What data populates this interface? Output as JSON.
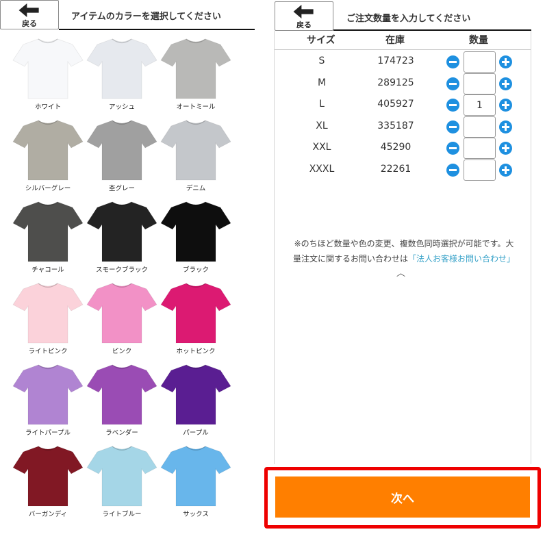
{
  "left": {
    "back_label": "戻る",
    "title": "アイテムのカラーを選択してください",
    "colors": [
      {
        "name": "ホワイト",
        "hex": "#f7f8fa"
      },
      {
        "name": "アッシュ",
        "hex": "#e6e9ee"
      },
      {
        "name": "オートミール",
        "hex": "#b9b9b7"
      },
      {
        "name": "シルバーグレー",
        "hex": "#b0ada3"
      },
      {
        "name": "杢グレー",
        "hex": "#a0a0a0"
      },
      {
        "name": "デニム",
        "hex": "#c4c7cb"
      },
      {
        "name": "チャコール",
        "hex": "#4e4e4c"
      },
      {
        "name": "スモークブラック",
        "hex": "#232323"
      },
      {
        "name": "ブラック",
        "hex": "#0e0e0e"
      },
      {
        "name": "ライトピンク",
        "hex": "#fbd2da"
      },
      {
        "name": "ピンク",
        "hex": "#f291c6"
      },
      {
        "name": "ホットピンク",
        "hex": "#dc1a72"
      },
      {
        "name": "ライトパープル",
        "hex": "#b084d2"
      },
      {
        "name": "ラベンダー",
        "hex": "#9a4cb4"
      },
      {
        "name": "パープル",
        "hex": "#5a1e92"
      },
      {
        "name": "バーガンディ",
        "hex": "#811824"
      },
      {
        "name": "ライトブルー",
        "hex": "#a5d6e7"
      },
      {
        "name": "サックス",
        "hex": "#68b6eb"
      }
    ]
  },
  "right": {
    "back_label": "戻る",
    "title": "ご注文数量を入力してください",
    "col_size": "サイズ",
    "col_stock": "在庫",
    "col_qty": "数量",
    "rows": [
      {
        "size": "S",
        "stock": "174723",
        "qty": ""
      },
      {
        "size": "M",
        "stock": "289125",
        "qty": ""
      },
      {
        "size": "L",
        "stock": "405927",
        "qty": "1"
      },
      {
        "size": "XL",
        "stock": "335187",
        "qty": ""
      },
      {
        "size": "XXL",
        "stock": "45290",
        "qty": ""
      },
      {
        "size": "XXXL",
        "stock": "22261",
        "qty": ""
      }
    ],
    "note_line1": "※のちほど数量や色の変更、複数色同時選択が可能です。大",
    "note_line2_prefix": "量注文に関するお問い合わせは",
    "note_link": "「法人お客様お問い合わせ」",
    "caret": "︿",
    "next_label": "次へ",
    "next_color": "#ff7f00",
    "highlight_color": "#ee0000",
    "accent_color": "#1e90e0"
  }
}
